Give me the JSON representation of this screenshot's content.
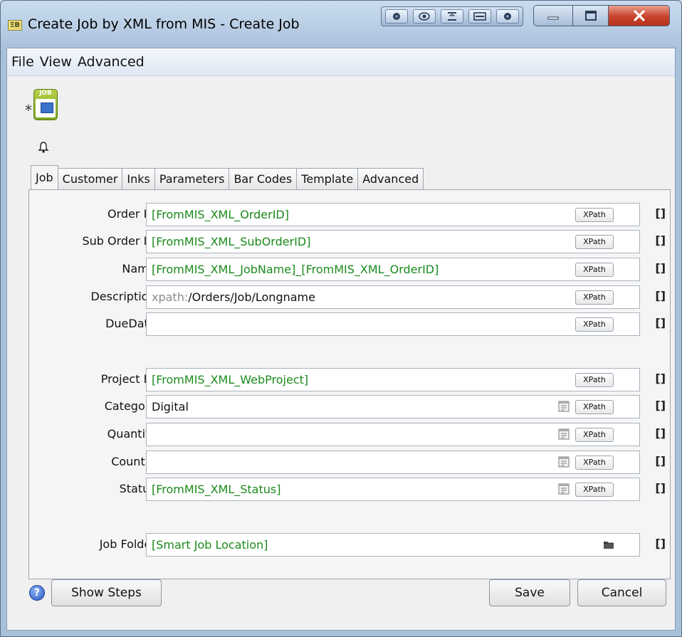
{
  "window": {
    "title": "Create Job by XML from MIS - Create Job",
    "title_icon_text": "ΞΒ",
    "buttons": {
      "minimize": "minimize",
      "maximize": "maximize",
      "close": "close"
    }
  },
  "menu": [
    "File",
    "View",
    "Advanced"
  ],
  "job_icon": {
    "caption": "JOB",
    "star": "*"
  },
  "tabs": [
    "Job",
    "Customer",
    "Inks",
    "Parameters",
    "Bar Codes",
    "Template",
    "Advanced"
  ],
  "active_tab": "Job",
  "fields": [
    {
      "label": "Order ID:",
      "value": "[FromMIS_XML_OrderID]",
      "xpath": "XPath",
      "brackets": "[]"
    },
    {
      "label": "Sub Order ID:",
      "value": "[FromMIS_XML_SubOrderID]",
      "xpath": "XPath",
      "brackets": "[]"
    },
    {
      "label": "Name:",
      "value": "[FromMIS_XML_JobName]_[FromMIS_XML_OrderID]",
      "xpath": "XPath",
      "brackets": "[]"
    },
    {
      "label": "Description:",
      "prefix": "xpath:",
      "value": "/Orders/Job/Longname",
      "xpath": "XPath",
      "brackets": "[]"
    },
    {
      "label": "DueDate:",
      "value": "",
      "xpath": "XPath",
      "brackets": "[]"
    },
    {
      "label": "Project ID:",
      "value": "[FromMIS_XML_WebProject]",
      "xpath": "XPath",
      "brackets": "[]"
    },
    {
      "label": "Category:",
      "value": "Digital",
      "xpath": "XPath",
      "brackets": "[]"
    },
    {
      "label": "Quantity:",
      "value": "",
      "xpath": "XPath",
      "brackets": "[]"
    },
    {
      "label": "Country:",
      "value": "",
      "xpath": "XPath",
      "brackets": "[]"
    },
    {
      "label": "Status:",
      "value": "[FromMIS_XML_Status]",
      "xpath": "XPath",
      "brackets": "[]"
    },
    {
      "label": "Job Folder:",
      "value": "[Smart Job Location]",
      "brackets": "[]"
    }
  ],
  "footer": {
    "help": "?",
    "show_steps": "Show Steps",
    "save": "Save",
    "cancel": "Cancel"
  },
  "colors": {
    "variable_text": "#1b8a1b",
    "close_button": "#c9412a"
  }
}
